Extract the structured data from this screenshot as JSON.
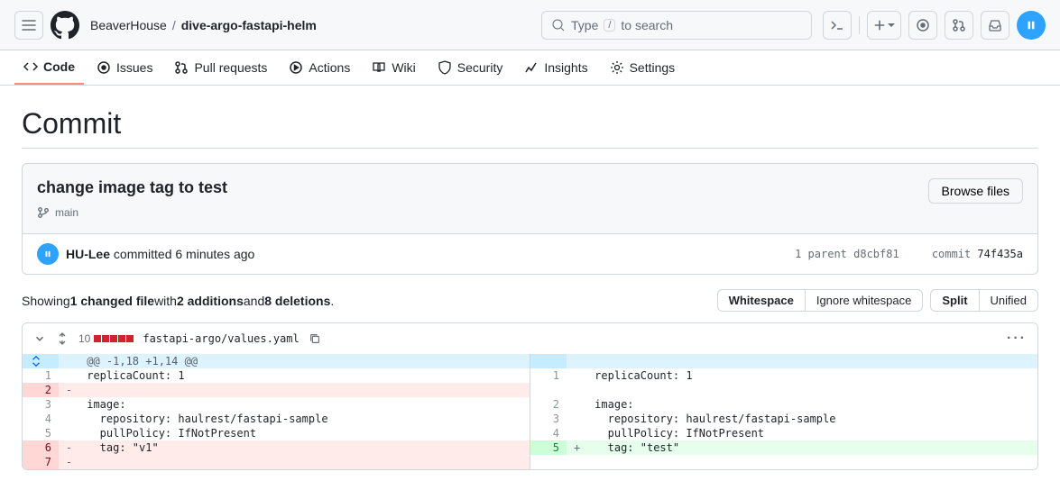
{
  "header": {
    "owner": "BeaverHouse",
    "sep": "/",
    "repo": "dive-argo-fastapi-helm",
    "search_pre": "Type",
    "search_kbd": "/",
    "search_post": "to search"
  },
  "tabs": {
    "code": "Code",
    "issues": "Issues",
    "pulls": "Pull requests",
    "actions": "Actions",
    "wiki": "Wiki",
    "security": "Security",
    "insights": "Insights",
    "settings": "Settings"
  },
  "page_title": "Commit",
  "commit": {
    "title": "change image tag to test",
    "branch": "main",
    "browse_btn": "Browse files",
    "author": "HU-Lee",
    "committed_text": " committed 6 minutes ago",
    "parent_label": "1 parent ",
    "parent_sha": "d8cbf81",
    "commit_label": "commit",
    "commit_sha": "74f435a"
  },
  "summary": {
    "pre": "Showing ",
    "files": "1 changed file",
    "mid1": " with ",
    "adds": "2 additions",
    "mid2": " and ",
    "dels": "8 deletions",
    "end": ".",
    "whitespace": "Whitespace",
    "ignore_whitespace": "Ignore whitespace",
    "split": "Split",
    "unified": "Unified"
  },
  "file": {
    "count": "10",
    "path": "fastapi-argo/values.yaml"
  },
  "diff": {
    "hunk": "@@ -1,18 +1,14 @@",
    "left": {
      "1": "replicaCount: 1",
      "2": "",
      "3": "image:",
      "4": "  repository: haulrest/fastapi-sample",
      "5": "  pullPolicy: IfNotPresent",
      "6": "  tag: \"v1\"",
      "7": ""
    },
    "right": {
      "1": "replicaCount: 1",
      "2": "image:",
      "3": "  repository: haulrest/fastapi-sample",
      "4": "  pullPolicy: IfNotPresent",
      "5": "  tag: \"test\""
    },
    "ln": {
      "l1": "1",
      "l2": "2",
      "l3": "3",
      "l4": "4",
      "l5": "5",
      "l6": "6",
      "l7": "7",
      "r1": "1",
      "r2": "2",
      "r3": "3",
      "r4": "4",
      "r5": "5"
    }
  }
}
